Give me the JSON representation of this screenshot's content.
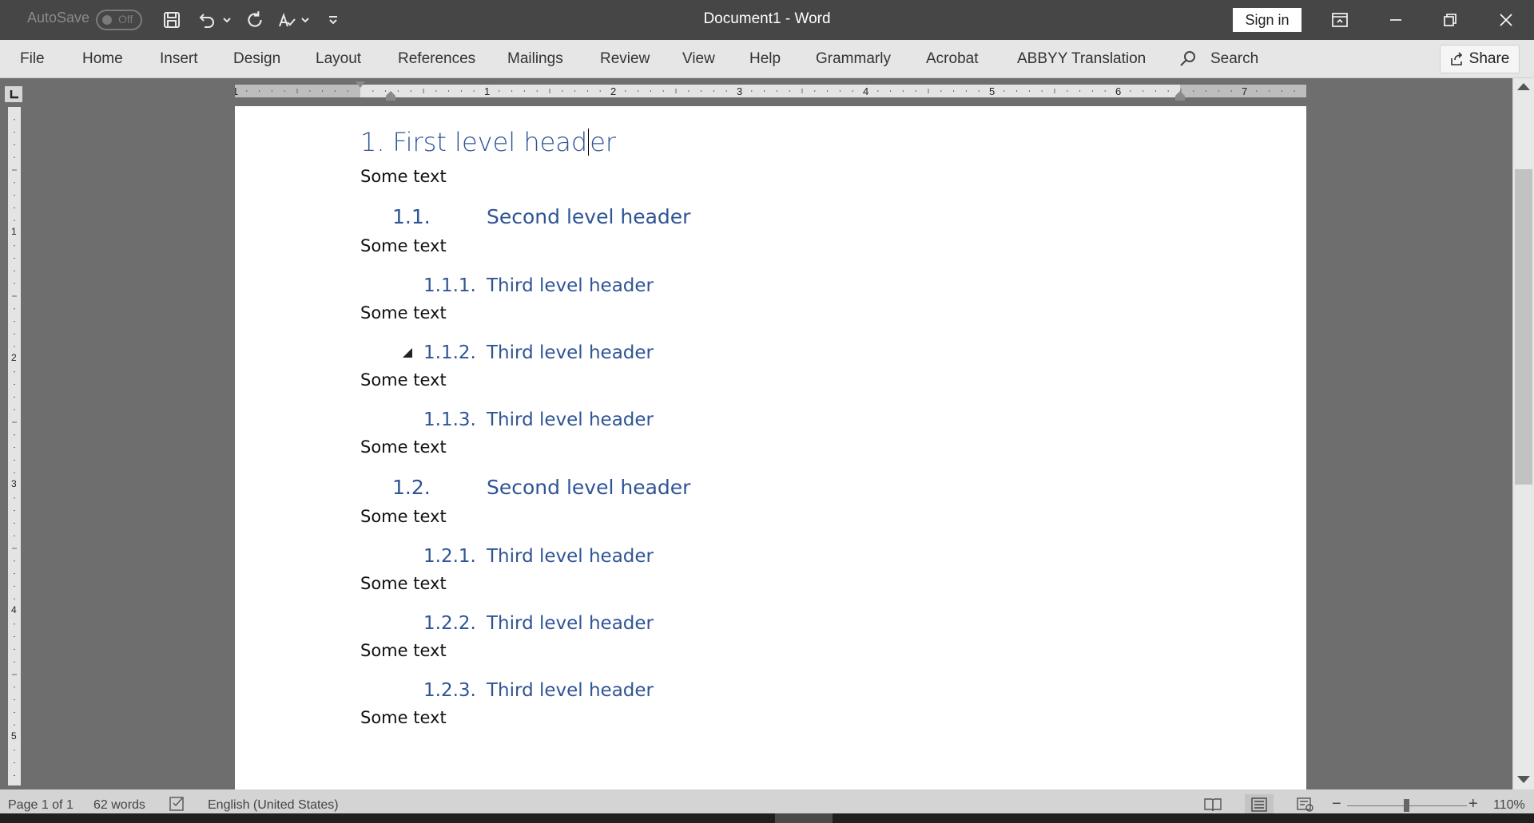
{
  "titlebar": {
    "autosave_label": "AutoSave",
    "autosave_state": "Off",
    "document_title": "Document1  -  Word",
    "signin_label": "Sign in",
    "icons": [
      "save-icon",
      "undo-icon",
      "redo-icon",
      "spelling-icon",
      "customize-qat-icon",
      "ribbon-display-icon",
      "minimize-icon",
      "restore-icon",
      "close-icon"
    ]
  },
  "ribbon": {
    "tabs": [
      "File",
      "Home",
      "Insert",
      "Design",
      "Layout",
      "References",
      "Mailings",
      "Review",
      "View",
      "Help",
      "Grammarly",
      "Acrobat",
      "ABBYY Translation"
    ],
    "search_label": "Search",
    "share_label": "Share"
  },
  "ruler": {
    "horizontal_numbers": [
      "1",
      "1",
      "2",
      "3",
      "4",
      "5",
      "6",
      "7"
    ],
    "vertical_numbers": [
      "1",
      "2",
      "3",
      "4",
      "5"
    ]
  },
  "document": {
    "heading1": {
      "number": "1.",
      "text_before_cursor": "First level head",
      "text_after_cursor": "er"
    },
    "sections": [
      {
        "level": 0,
        "text": "Some text"
      },
      {
        "level": 2,
        "number": "1.1.",
        "text": "Second level header"
      },
      {
        "level": 0,
        "text": "Some text"
      },
      {
        "level": 3,
        "number": "1.1.1.",
        "text": "Third level header"
      },
      {
        "level": 0,
        "text": "Some text"
      },
      {
        "level": 3,
        "number": "1.1.2.",
        "text": "Third level header",
        "collapse_marker": true
      },
      {
        "level": 0,
        "text": "Some text"
      },
      {
        "level": 3,
        "number": "1.1.3.",
        "text": "Third level header"
      },
      {
        "level": 0,
        "text": "Some text"
      },
      {
        "level": 2,
        "number": "1.2.",
        "text": "Second level header"
      },
      {
        "level": 0,
        "text": "Some text"
      },
      {
        "level": 3,
        "number": "1.2.1.",
        "text": "Third level header"
      },
      {
        "level": 0,
        "text": "Some text"
      },
      {
        "level": 3,
        "number": "1.2.2.",
        "text": "Third level header"
      },
      {
        "level": 0,
        "text": "Some text"
      },
      {
        "level": 3,
        "number": "1.2.3.",
        "text": "Third level header"
      },
      {
        "level": 0,
        "text": "Some text"
      }
    ]
  },
  "statusbar": {
    "page": "Page 1 of 1",
    "words": "62 words",
    "language": "English (United States)",
    "zoom_percent": "110%",
    "zoom_minus": "−",
    "zoom_plus": "+"
  },
  "colors": {
    "heading": "#2f5496",
    "titlebar_bg": "#464646",
    "ribbon_bg": "#e6e6e6",
    "canvas_bg": "#6e6e6e"
  }
}
